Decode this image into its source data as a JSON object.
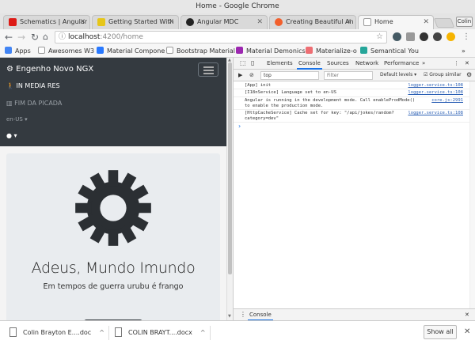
{
  "window": {
    "title": "Home - Google Chrome"
  },
  "tabs": [
    {
      "label": "Schematics | Angular",
      "favicon_color": "#dd1b16",
      "active": false
    },
    {
      "label": "Getting Started With",
      "favicon_color": "#e6c619",
      "active": false
    },
    {
      "label": "Angular MDC",
      "favicon_color": "#222222",
      "active": false
    },
    {
      "label": "Creating Beautiful An",
      "favicon_color": "#f25f2c",
      "active": false
    },
    {
      "label": "Home",
      "favicon_color": "#ffffff",
      "active": true
    }
  ],
  "profile_label": "Colin",
  "address": {
    "host": "localhost",
    "path": ":4200/home"
  },
  "bookmarks": [
    {
      "label": "Apps",
      "color": "#4285f4"
    },
    {
      "label": "Awesomes W3",
      "color": "#999999"
    },
    {
      "label": "Material Compone",
      "color": "#2979ff"
    },
    {
      "label": "Bootstrap Material",
      "color": "#ffffff"
    },
    {
      "label": "Material Demonics",
      "color": "#9c27b0"
    },
    {
      "label": "Materialize-o",
      "color": "#ee6e73"
    },
    {
      "label": "Semantical You",
      "color": "#26a69a"
    }
  ],
  "app": {
    "brand": "Engenho Novo NGX",
    "nav": {
      "media": "IN MEDIA RES",
      "fim": "FIM DA PICADA",
      "lang": "en-US"
    },
    "hero": {
      "title": "Adeus, Mundo Imundo",
      "subtitle": "Em tempos de guerra urubu é frango"
    }
  },
  "devtools": {
    "tabs": [
      "Elements",
      "Console",
      "Sources",
      "Network",
      "Performance"
    ],
    "active_tab": "Console",
    "context": "top",
    "filter_placeholder": "Filter",
    "levels": "Default levels",
    "group_similar": "Group similar",
    "logs": [
      {
        "msg": "[App] init",
        "src": "logger.service.ts:108"
      },
      {
        "msg": "[I18nService] Language set to en-US",
        "src": "logger.service.ts:108"
      },
      {
        "msg": "Angular is running in the development mode. Call enableProdMode()\nto enable the production mode.",
        "src": "core.js:2991"
      },
      {
        "msg": "[HttpCacheService] Cache set for key: \"/api/jokes/random?\ncategory=dev\"",
        "src": "logger.service.ts:108"
      }
    ],
    "drawer_tab": "Console"
  },
  "downloads": {
    "items": [
      {
        "name": "Colin Brayton E....doc"
      },
      {
        "name": "COLIN BRAYT....docx"
      }
    ],
    "show_all": "Show all"
  }
}
